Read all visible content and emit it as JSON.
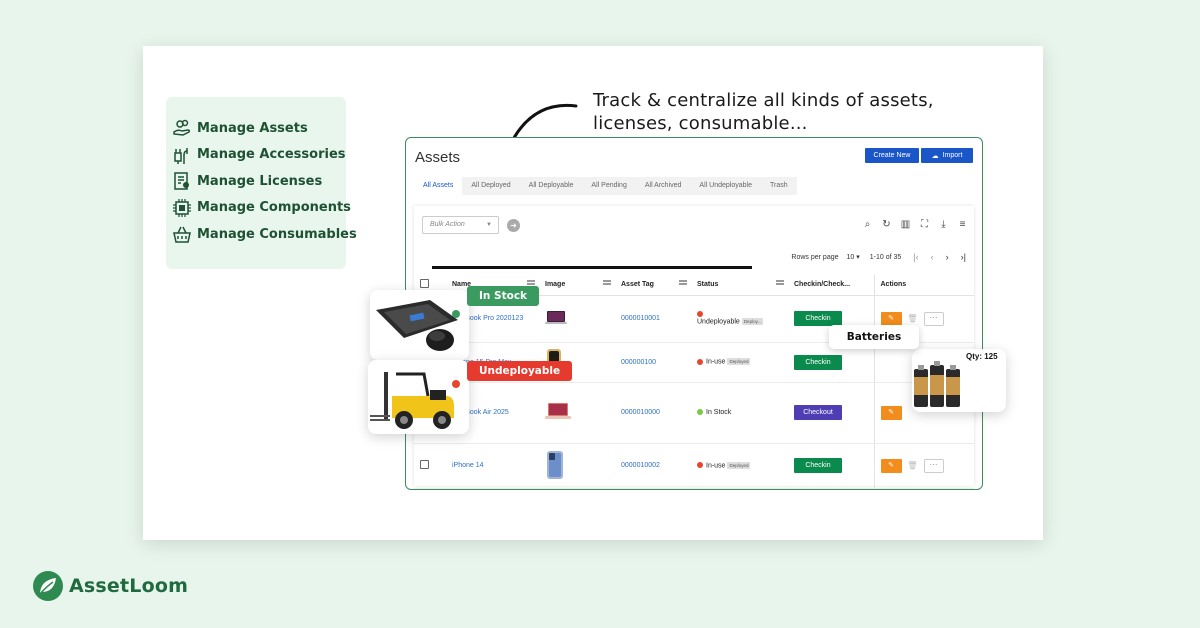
{
  "features": [
    {
      "label": "Manage Assets",
      "icon": "hand-coins-icon"
    },
    {
      "label": "Manage Accessories",
      "icon": "plug-icon"
    },
    {
      "label": "Manage Licenses",
      "icon": "license-icon"
    },
    {
      "label": "Manage Components",
      "icon": "chip-icon"
    },
    {
      "label": "Manage Consumables",
      "icon": "basket-icon"
    }
  ],
  "headline": {
    "line1": "Track & centralize all kinds of assets,",
    "line2": "licenses, consumable..."
  },
  "app": {
    "title": "Assets",
    "create_label": "Create New",
    "import_label": "Import",
    "tabs": [
      "All Assets",
      "All Deployed",
      "All Deployable",
      "All Pending",
      "All Archived",
      "All Undeployable",
      "Trash"
    ],
    "bulk_placeholder": "Bulk Action",
    "rows_per_page_label": "Rows per page",
    "rows_per_page": "10",
    "range": "1-10 of 35",
    "columns": [
      "Name",
      "Image",
      "Asset Tag",
      "Status",
      "Checkin/Check...",
      "Actions"
    ],
    "rows": [
      {
        "name": "MacBook Pro 2020123",
        "tag": "0000010001",
        "status": "Undeployable",
        "badge": "Deploy...",
        "status_color": "#e8452e",
        "action": "Checkin"
      },
      {
        "name": "iPhone 15 Pro Max",
        "tag": "000000100",
        "status": "In-use",
        "badge": "Deployed",
        "status_color": "#e8452e",
        "action": "Checkin"
      },
      {
        "name": "MacBook Air 2025",
        "tag": "0000010000",
        "status": "In Stock",
        "badge": "",
        "status_color": "#7ac943",
        "action": "Checkout"
      },
      {
        "name": "iPhone 14",
        "tag": "0000010002",
        "status": "In-use",
        "badge": "Deployed",
        "status_color": "#e8452e",
        "action": "Checkin"
      }
    ]
  },
  "floats": {
    "in_stock": "In Stock",
    "undeployable": "Undeployable",
    "batteries": "Batteries",
    "qty": "Qty: 125"
  },
  "colors": {
    "brand": "#1f6a3e",
    "primary": "#1a56c7",
    "checkin": "#0b8a4d",
    "checkout": "#4f3db4",
    "edit": "#f28c1c",
    "in_stock_tag": "#3a9a60",
    "undeployable_tag": "#e53a2e"
  },
  "logo": {
    "text": "AssetLoom"
  }
}
